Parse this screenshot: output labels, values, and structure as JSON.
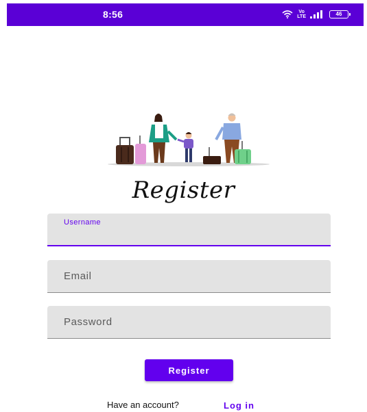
{
  "status_bar": {
    "time": "8:56",
    "network_top": "Vo",
    "network_bottom": "LTE",
    "battery": "46",
    "color": "#5a00d6"
  },
  "illustration": {
    "icon": "family-travel-illustration"
  },
  "title": "Register",
  "form": {
    "username": {
      "label": "Username",
      "value": ""
    },
    "email": {
      "placeholder": "Email"
    },
    "password": {
      "placeholder": "Password"
    }
  },
  "register_button": {
    "label": "Register",
    "color": "#6200ee"
  },
  "footer": {
    "prompt": "Have an account?",
    "login_label": "Log in"
  }
}
